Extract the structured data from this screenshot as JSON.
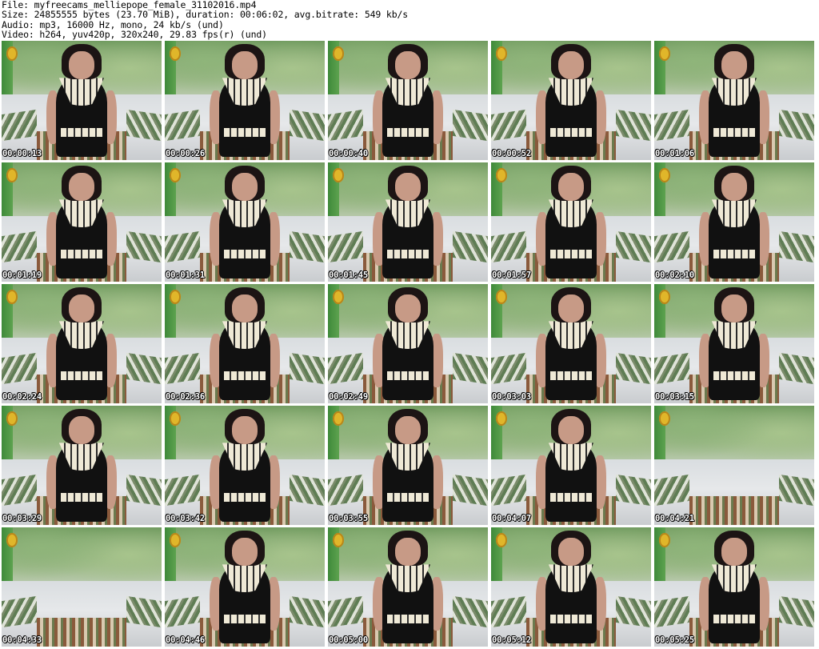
{
  "header": {
    "file_line": "File: myfreecams_melliepope_female_31102016.mp4",
    "size_line": "Size: 24855555 bytes (23.70 MiB), duration: 00:06:02, avg.bitrate: 549 kb/s",
    "audio_line": "Audio: mp3, 16000 Hz, mono, 24 kb/s (und)",
    "video_line": "Video: h264, yuv420p, 320x240, 29.83 fps(r) (und)"
  },
  "thumbnails": [
    {
      "timestamp": "00:00:13",
      "has_person": true
    },
    {
      "timestamp": "00:00:26",
      "has_person": true
    },
    {
      "timestamp": "00:00:40",
      "has_person": true
    },
    {
      "timestamp": "00:00:52",
      "has_person": true
    },
    {
      "timestamp": "00:01:06",
      "has_person": true
    },
    {
      "timestamp": "00:01:19",
      "has_person": true
    },
    {
      "timestamp": "00:01:31",
      "has_person": true
    },
    {
      "timestamp": "00:01:45",
      "has_person": true
    },
    {
      "timestamp": "00:01:57",
      "has_person": true
    },
    {
      "timestamp": "00:02:10",
      "has_person": true
    },
    {
      "timestamp": "00:02:24",
      "has_person": true
    },
    {
      "timestamp": "00:02:36",
      "has_person": true
    },
    {
      "timestamp": "00:02:49",
      "has_person": true
    },
    {
      "timestamp": "00:03:03",
      "has_person": true
    },
    {
      "timestamp": "00:03:15",
      "has_person": true
    },
    {
      "timestamp": "00:03:29",
      "has_person": true
    },
    {
      "timestamp": "00:03:42",
      "has_person": true
    },
    {
      "timestamp": "00:03:55",
      "has_person": true
    },
    {
      "timestamp": "00:04:07",
      "has_person": true
    },
    {
      "timestamp": "00:04:21",
      "has_person": false
    },
    {
      "timestamp": "00:04:33",
      "has_person": false
    },
    {
      "timestamp": "00:04:46",
      "has_person": true
    },
    {
      "timestamp": "00:05:00",
      "has_person": true
    },
    {
      "timestamp": "00:05:12",
      "has_person": true
    },
    {
      "timestamp": "00:05:25",
      "has_person": true
    }
  ]
}
